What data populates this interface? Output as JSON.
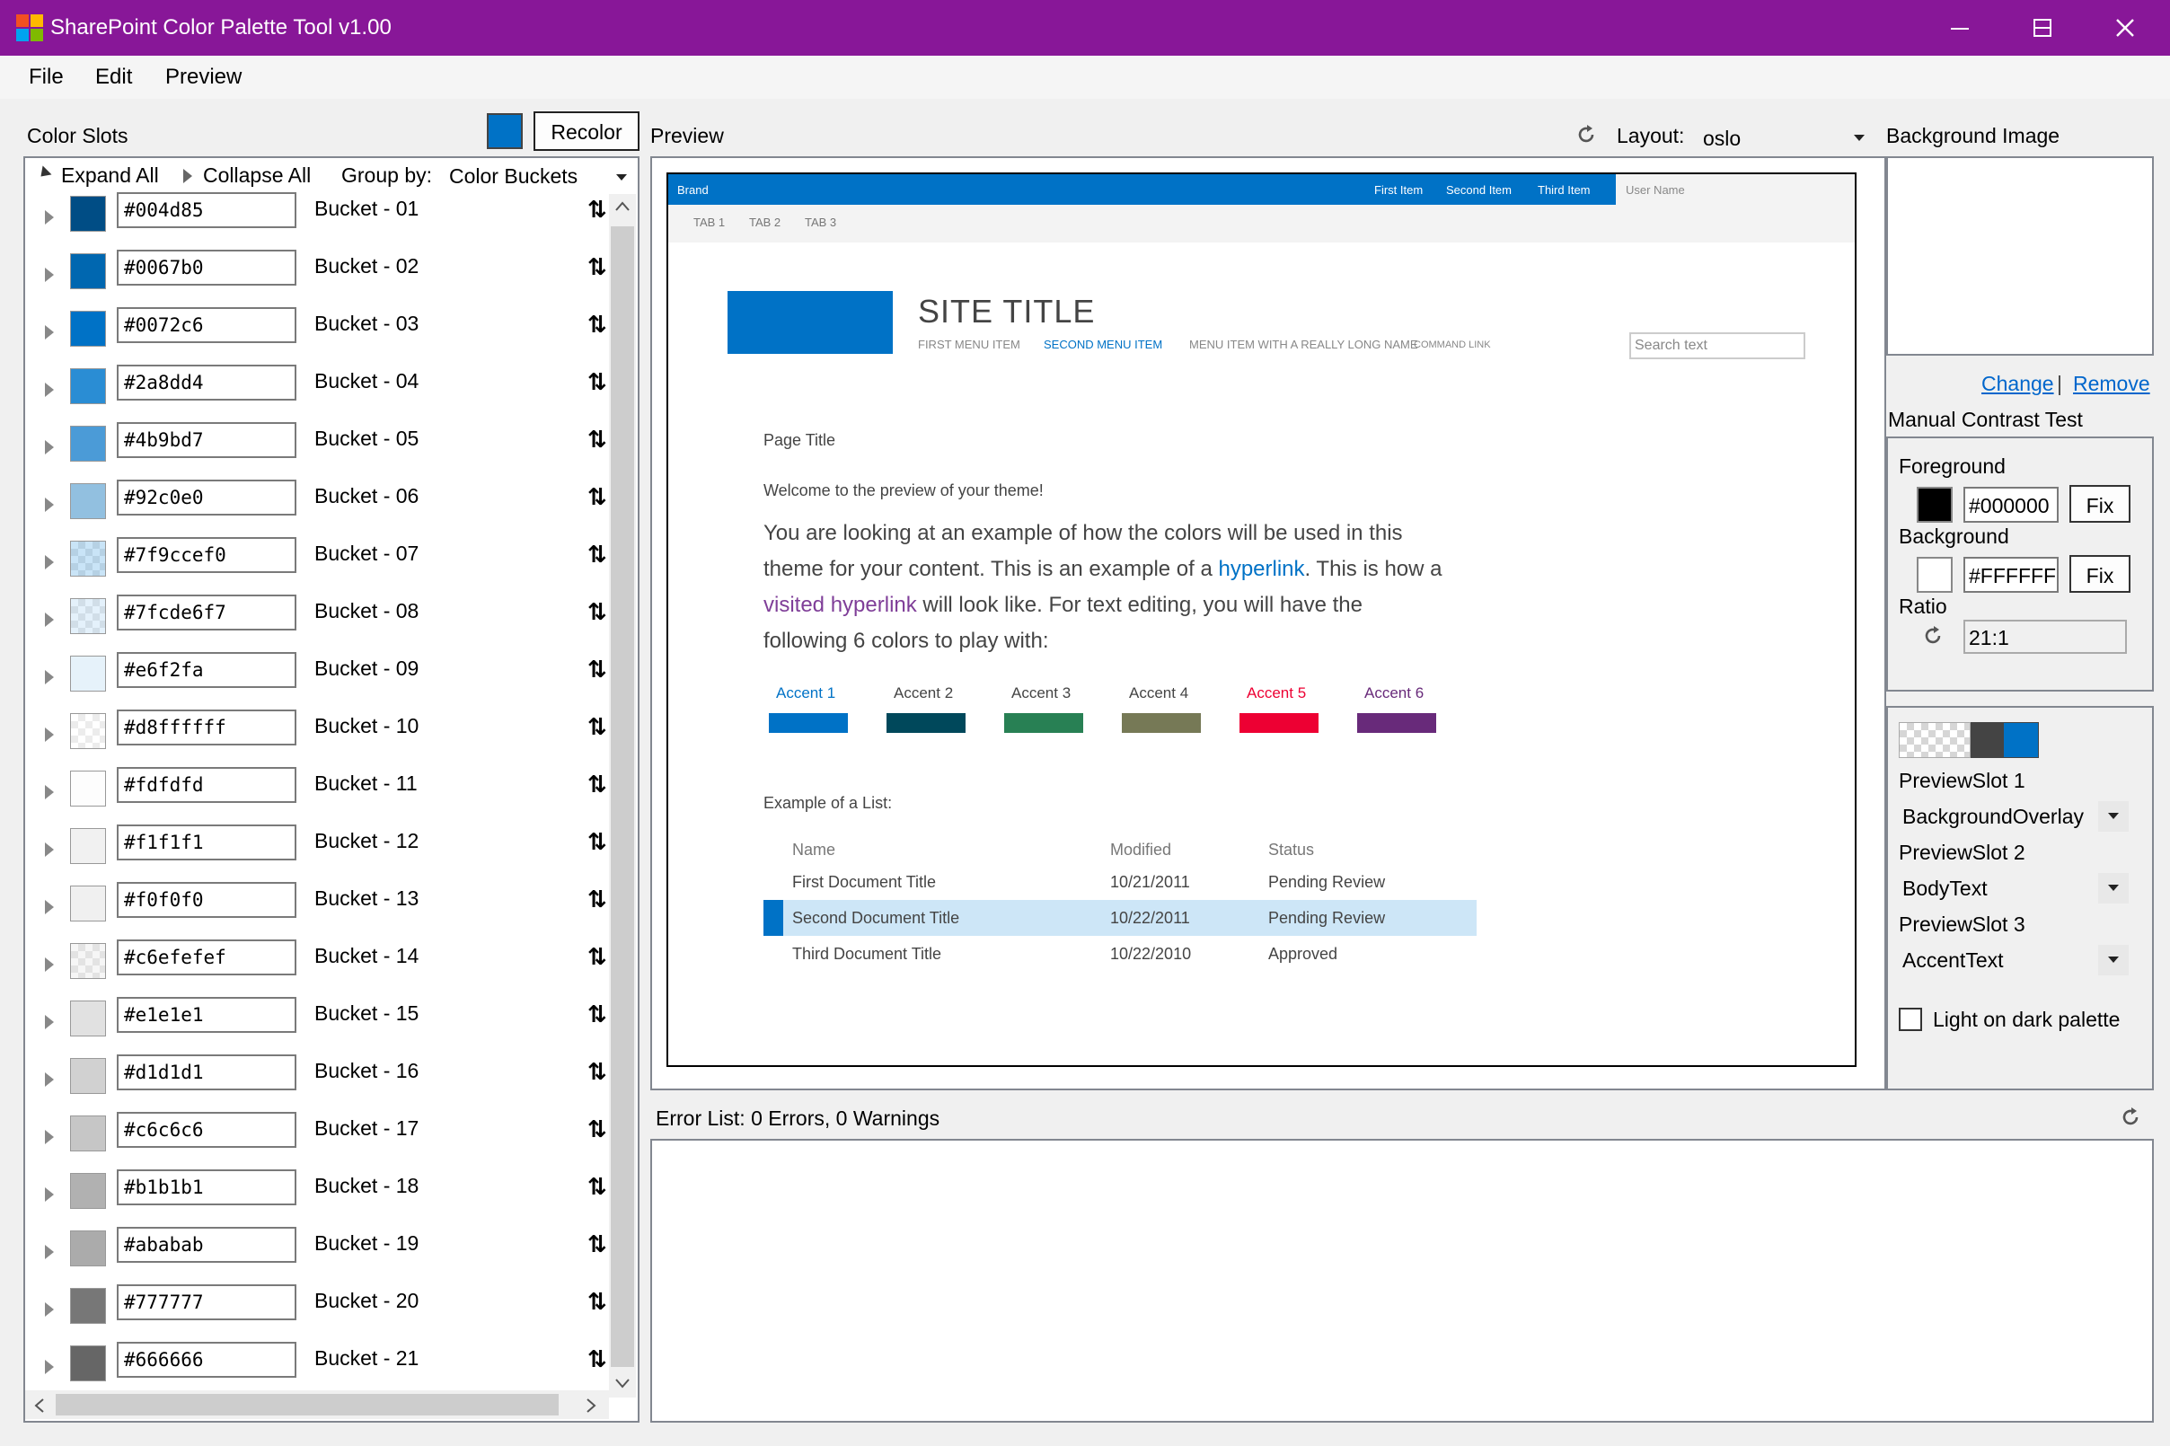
{
  "window": {
    "title": "SharePoint Color Palette Tool v1.00",
    "minimize": "—",
    "maximize": "☐",
    "close": "✕"
  },
  "menu": {
    "file": "File",
    "edit": "Edit",
    "preview": "Preview"
  },
  "color_slots": {
    "title": "Color Slots",
    "recolor_button": "Recolor",
    "recolor_swatch_color": "#0072c6",
    "expand_all": "Expand All",
    "collapse_all": "Collapse All",
    "group_by_label": "Group by:",
    "group_by_value": "Color Buckets",
    "items": [
      {
        "hex": "#004d85",
        "bucket": "Bucket - 01",
        "color": "#004d85"
      },
      {
        "hex": "#0067b0",
        "bucket": "Bucket - 02",
        "color": "#0067b0"
      },
      {
        "hex": "#0072c6",
        "bucket": "Bucket - 03",
        "color": "#0072c6"
      },
      {
        "hex": "#2a8dd4",
        "bucket": "Bucket - 04",
        "color": "#2a8dd4"
      },
      {
        "hex": "#4b9bd7",
        "bucket": "Bucket - 05",
        "color": "#4b9bd7"
      },
      {
        "hex": "#92c0e0",
        "bucket": "Bucket - 06",
        "color": "#92c0e0"
      },
      {
        "hex": "#7f9ccef0",
        "bucket": "Bucket - 07",
        "color": "#9ccef0"
      },
      {
        "hex": "#7fcde6f7",
        "bucket": "Bucket - 08",
        "color": "#cde6f7"
      },
      {
        "hex": "#e6f2fa",
        "bucket": "Bucket - 09",
        "color": "#e6f2fa"
      },
      {
        "hex": "#d8ffffff",
        "bucket": "Bucket - 10",
        "color": "#ffffff"
      },
      {
        "hex": "#fdfdfd",
        "bucket": "Bucket - 11",
        "color": "#fdfdfd"
      },
      {
        "hex": "#f1f1f1",
        "bucket": "Bucket - 12",
        "color": "#f1f1f1"
      },
      {
        "hex": "#f0f0f0",
        "bucket": "Bucket - 13",
        "color": "#f0f0f0"
      },
      {
        "hex": "#c6efefef",
        "bucket": "Bucket - 14",
        "color": "#efefef"
      },
      {
        "hex": "#e1e1e1",
        "bucket": "Bucket - 15",
        "color": "#e1e1e1"
      },
      {
        "hex": "#d1d1d1",
        "bucket": "Bucket - 16",
        "color": "#d1d1d1"
      },
      {
        "hex": "#c6c6c6",
        "bucket": "Bucket - 17",
        "color": "#c6c6c6"
      },
      {
        "hex": "#b1b1b1",
        "bucket": "Bucket - 18",
        "color": "#b1b1b1"
      },
      {
        "hex": "#ababab",
        "bucket": "Bucket - 19",
        "color": "#ababab"
      },
      {
        "hex": "#777777",
        "bucket": "Bucket - 20",
        "color": "#777777"
      },
      {
        "hex": "#666666",
        "bucket": "Bucket - 21",
        "color": "#666666"
      }
    ]
  },
  "preview": {
    "title": "Preview",
    "layout_label": "Layout:",
    "layout_value": "oslo",
    "site": {
      "brand": "Brand",
      "top_nav": [
        "First Item",
        "Second Item",
        "Third Item"
      ],
      "user_name": "User Name",
      "tabs": [
        "TAB 1",
        "TAB 2",
        "TAB 3"
      ],
      "site_title": "SITE TITLE",
      "menu": [
        "FIRST MENU ITEM",
        "SECOND MENU ITEM",
        "MENU ITEM WITH A REALLY LONG NAME",
        "COMMAND LINK"
      ],
      "search_placeholder": "Search text",
      "page_title": "Page Title",
      "welcome": "Welcome to the preview of your theme!",
      "body_1": "You are looking at an example of how the colors will be used in this",
      "body_2a": "theme for your content. This is an example of a ",
      "body_2_link": "hyperlink",
      "body_2b": ". This is how a",
      "body_3_link": "visited hyperlink",
      "body_3b": " will look like. For text editing, you will have the",
      "body_4": "following 6 colors to play with:",
      "accents": [
        {
          "label": "Accent 1",
          "color": "#0072c6",
          "label_color": "#0072c6"
        },
        {
          "label": "Accent 2",
          "color": "#00485b",
          "label_color": "#444444"
        },
        {
          "label": "Accent 3",
          "color": "#288054",
          "label_color": "#444444"
        },
        {
          "label": "Accent 4",
          "color": "#767956",
          "label_color": "#444444"
        },
        {
          "label": "Accent 5",
          "color": "#ed0033",
          "label_color": "#ed0033"
        },
        {
          "label": "Accent 6",
          "color": "#682a7a",
          "label_color": "#682a7a"
        }
      ],
      "list_heading": "Example of a List:",
      "list_columns": [
        "Name",
        "Modified",
        "Status"
      ],
      "list_rows": [
        {
          "name": "First Document Title",
          "modified": "10/21/2011",
          "status": "Pending Review"
        },
        {
          "name": "Second Document Title",
          "modified": "10/22/2011",
          "status": "Pending Review"
        },
        {
          "name": "Third Document Title",
          "modified": "10/22/2010",
          "status": "Approved"
        }
      ]
    }
  },
  "background_image": {
    "title": "Background Image",
    "change_link": "Change",
    "separator": "|",
    "remove_link": "Remove"
  },
  "contrast": {
    "title": "Manual Contrast Test",
    "foreground_label": "Foreground",
    "foreground_value": "#000000",
    "foreground_color": "#000000",
    "background_label": "Background",
    "background_value": "#FFFFFF",
    "background_color": "#FFFFFF",
    "fix_label": "Fix",
    "ratio_label": "Ratio",
    "ratio_value": "21:1"
  },
  "preview_slots": {
    "slot1_label": "PreviewSlot 1",
    "slot1_value": "BackgroundOverlay",
    "slot2_label": "PreviewSlot 2",
    "slot2_value": "BodyText",
    "slot3_label": "PreviewSlot 3",
    "slot3_value": "AccentText",
    "light_on_dark_label": "Light on dark palette",
    "light_on_dark_checked": false
  },
  "error_list": {
    "title": "Error List: 0 Errors, 0 Warnings"
  }
}
